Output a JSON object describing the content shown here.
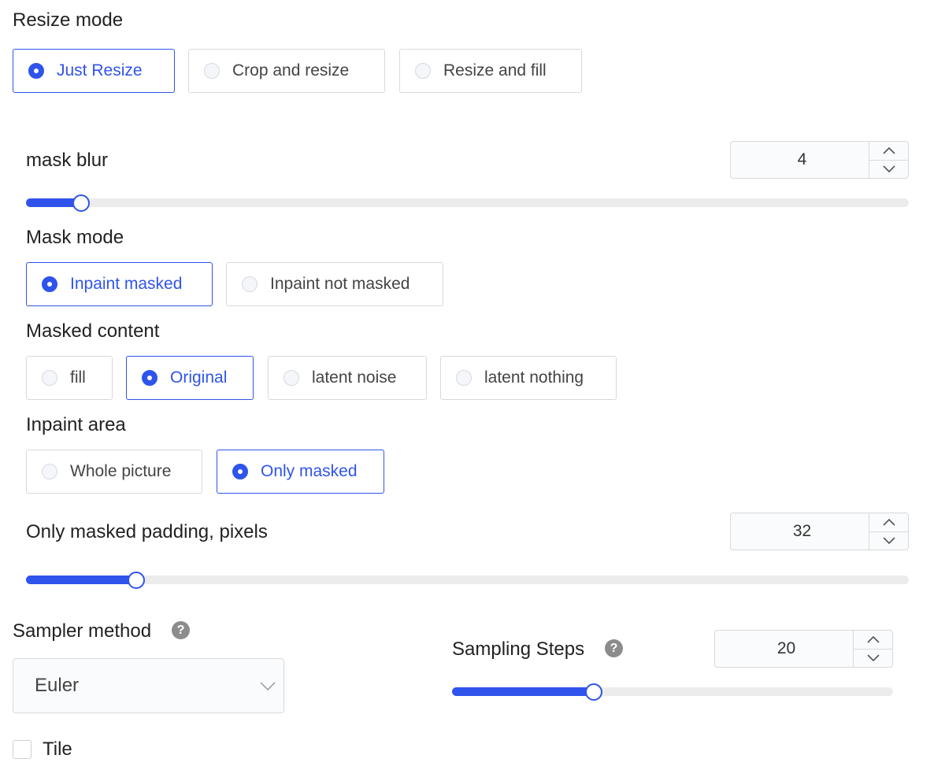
{
  "resize_mode": {
    "label": "Resize mode",
    "options": [
      "Just Resize",
      "Crop and resize",
      "Resize and fill"
    ],
    "selected": "Just Resize"
  },
  "mask_blur": {
    "label": "mask blur",
    "value": "4",
    "slider_fraction": 0.0625
  },
  "mask_mode": {
    "label": "Mask mode",
    "options": [
      "Inpaint masked",
      "Inpaint not masked"
    ],
    "selected": "Inpaint masked"
  },
  "masked_content": {
    "label": "Masked content",
    "options": [
      "fill",
      "Original",
      "latent noise",
      "latent nothing"
    ],
    "selected": "Original"
  },
  "inpaint_area": {
    "label": "Inpaint area",
    "options": [
      "Whole picture",
      "Only masked"
    ],
    "selected": "Only masked"
  },
  "padding": {
    "label": "Only masked padding, pixels",
    "value": "32",
    "slider_fraction": 0.125
  },
  "sampler": {
    "label": "Sampler method",
    "value": "Euler",
    "help_icon": "question-circle-icon"
  },
  "steps": {
    "label": "Sampling Steps",
    "value": "20",
    "slider_fraction": 0.322,
    "help_icon": "question-circle-icon"
  },
  "tile": {
    "label": "Tile",
    "checked": false
  },
  "colors": {
    "accent": "#2f54eb",
    "track": "#ececec",
    "border": "#d9d9d9"
  }
}
